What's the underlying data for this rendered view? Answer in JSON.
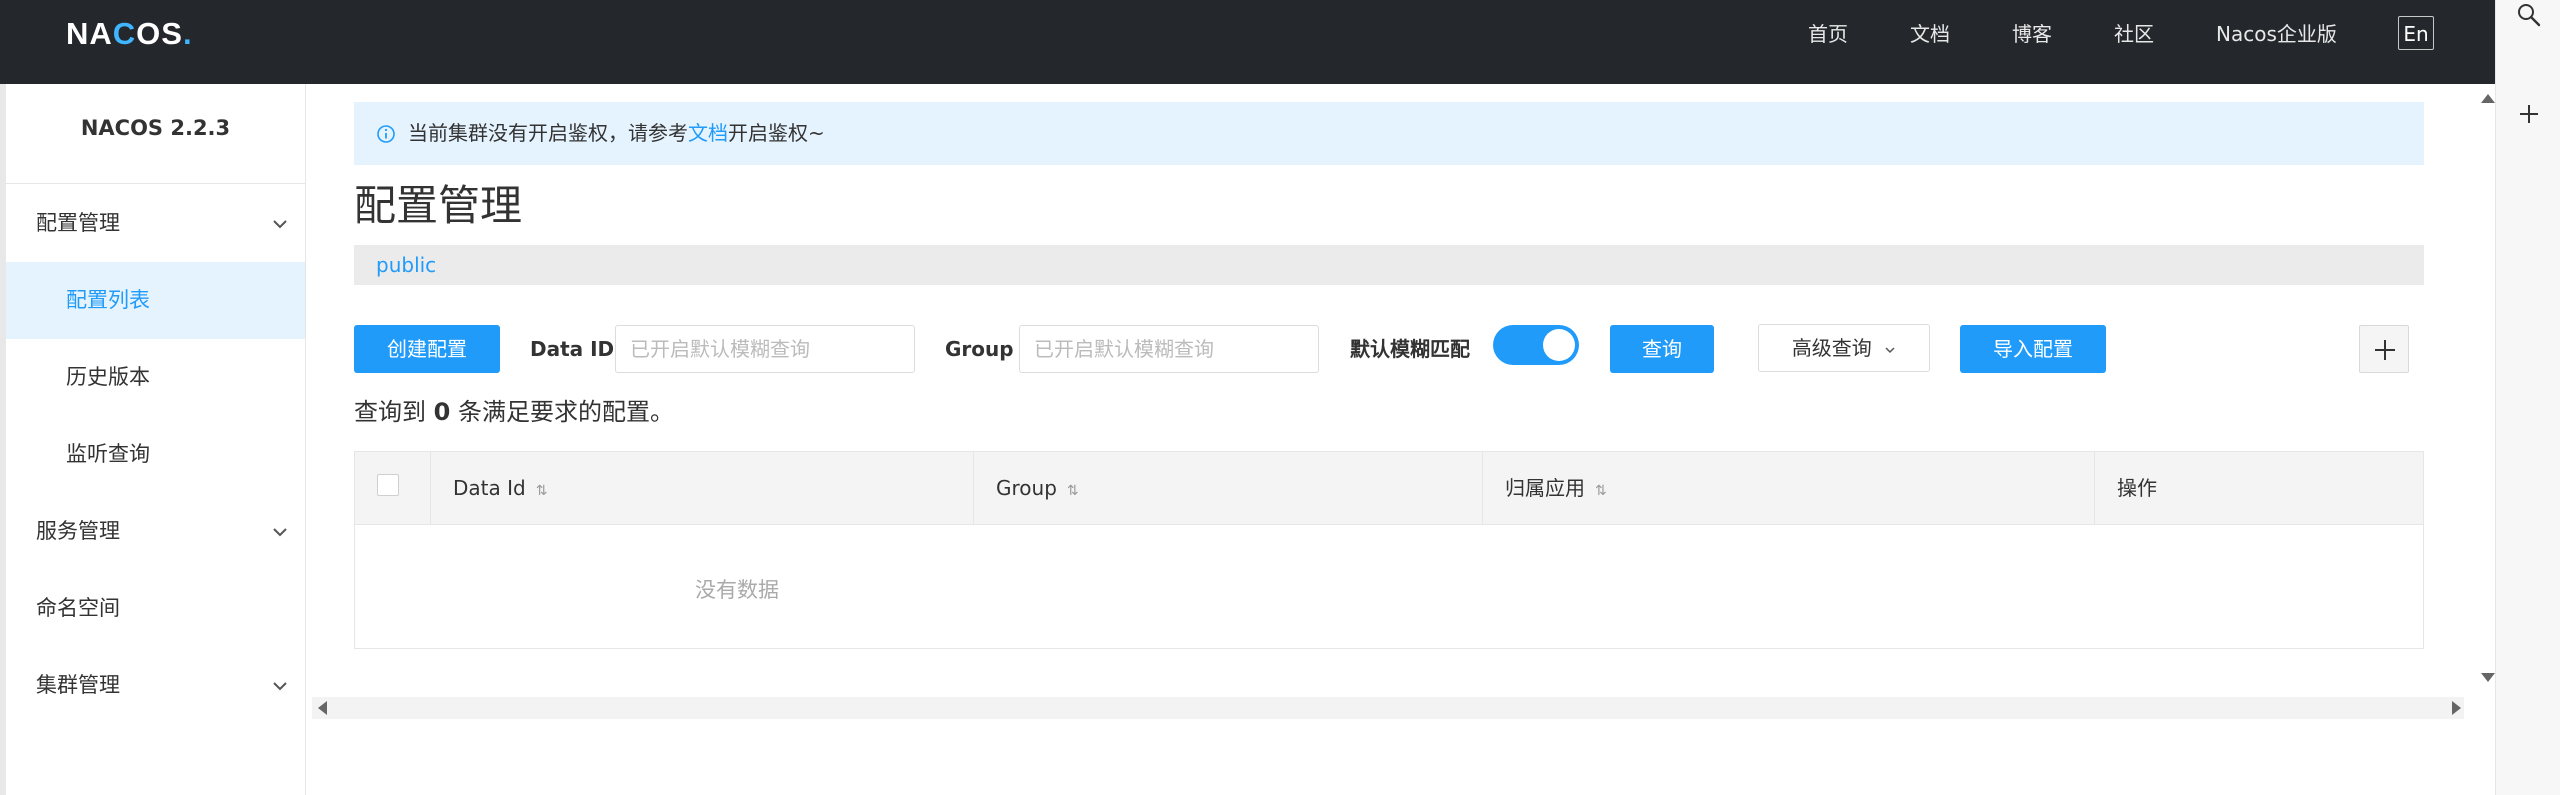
{
  "topbar": {
    "logo": {
      "part1": "NA",
      "part2": "C",
      "part3": "OS",
      "dot": "."
    },
    "nav": [
      "首页",
      "文档",
      "博客",
      "社区",
      "Nacos企业版"
    ],
    "lang": "En",
    "background_color": "#24282d"
  },
  "right_tools": {
    "icons": [
      "search-icon",
      "plus-icon"
    ]
  },
  "sidebar": {
    "version": "NACOS 2.2.3",
    "items": [
      {
        "label": "配置管理",
        "type": "group",
        "expanded": true
      },
      {
        "label": "配置列表",
        "type": "sub",
        "active": true
      },
      {
        "label": "历史版本",
        "type": "sub"
      },
      {
        "label": "监听查询",
        "type": "sub"
      },
      {
        "label": "服务管理",
        "type": "group"
      },
      {
        "label": "命名空间",
        "type": "group"
      },
      {
        "label": "集群管理",
        "type": "group"
      }
    ]
  },
  "alert": {
    "text_before": "当前集群没有开启鉴权，请参考",
    "link": "文档",
    "text_after": "开启鉴权~"
  },
  "page": {
    "title": "配置管理",
    "namespace": "public"
  },
  "toolbar": {
    "create_label": "创建配置",
    "data_id_label": "Data ID",
    "data_id_placeholder": "已开启默认模糊查询",
    "group_label": "Group",
    "group_placeholder": "已开启默认模糊查询",
    "fuzzy_label": "默认模糊匹配",
    "fuzzy_enabled": true,
    "search_label": "查询",
    "advanced_label": "高级查询",
    "import_label": "导入配置"
  },
  "result": {
    "prefix": "查询到 ",
    "count": "0",
    "suffix": " 条满足要求的配置。"
  },
  "table": {
    "columns": [
      "Data Id",
      "Group",
      "归属应用",
      "操作"
    ],
    "empty_text": "没有数据"
  },
  "colors": {
    "accent": "#209bfa",
    "alert_bg": "#e5f3ff"
  }
}
